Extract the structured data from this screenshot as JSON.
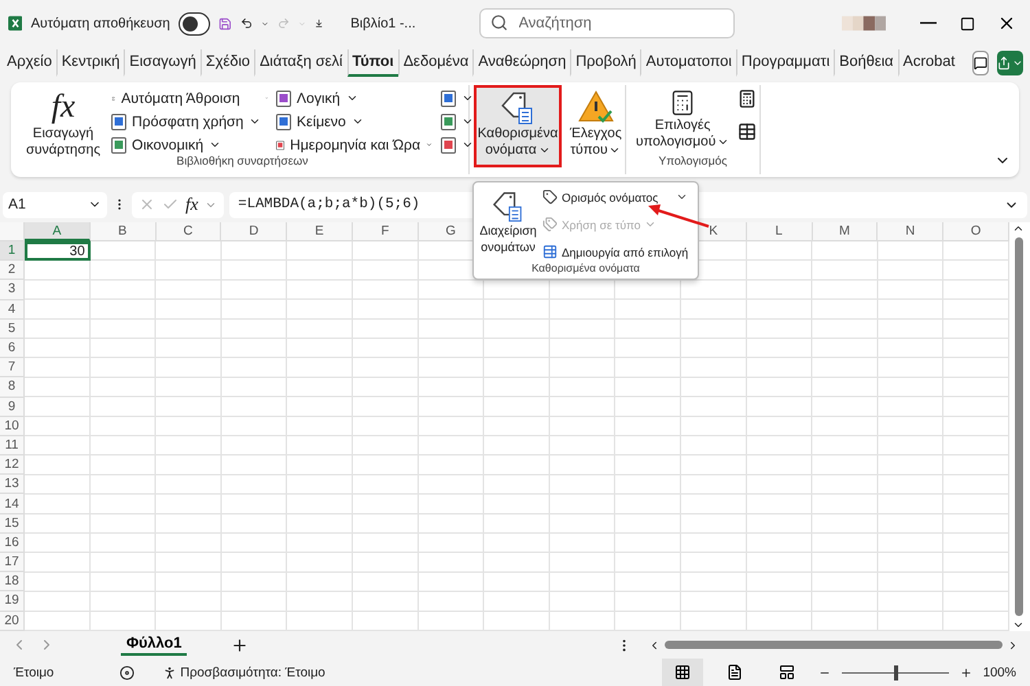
{
  "title_bar": {
    "autosave_label": "Αυτόματη αποθήκευση",
    "autosave_on": false,
    "document_title": "Βιβλίο1 -...",
    "search_placeholder": "Αναζήτηση"
  },
  "tabs": [
    {
      "label": "Αρχείο",
      "selected": false
    },
    {
      "label": "Κεντρική",
      "selected": false
    },
    {
      "label": "Εισαγωγή",
      "selected": false
    },
    {
      "label": "Σχέδιο",
      "selected": false
    },
    {
      "label": "Διάταξη σελί",
      "selected": false
    },
    {
      "label": "Τύποι",
      "selected": true
    },
    {
      "label": "Δεδομένα",
      "selected": false
    },
    {
      "label": "Αναθεώρηση",
      "selected": false
    },
    {
      "label": "Προβολή",
      "selected": false
    },
    {
      "label": "Αυτοματοποι",
      "selected": false
    },
    {
      "label": "Προγραμματι",
      "selected": false
    },
    {
      "label": "Βοήθεια",
      "selected": false
    },
    {
      "label": "Acrobat",
      "selected": false
    }
  ],
  "ribbon": {
    "function_library": {
      "label": "Βιβλιοθήκη συναρτήσεων",
      "insert_function": {
        "glyph": "fx",
        "lines": [
          "Εισαγωγή",
          "συνάρτησης"
        ]
      },
      "columns": [
        [
          {
            "label": "Αυτόματη Άθροιση",
            "kind": "sum",
            "split": true
          },
          {
            "label": "Πρόσφατη χρήση",
            "kind": "book",
            "color": "#2f6fd6"
          },
          {
            "label": "Οικονομική",
            "kind": "book",
            "color": "#3a9a5b"
          }
        ],
        [
          {
            "label": "Λογική",
            "kind": "book",
            "color": "#9b4dca"
          },
          {
            "label": "Κείμενο",
            "kind": "book",
            "color": "#2f6fd6"
          },
          {
            "label": "Ημερομηνία και Ώρα",
            "kind": "book",
            "color": "#e0454f"
          }
        ]
      ],
      "icon_menus": [
        {
          "color": "#2f6fd6"
        },
        {
          "color": "#3a9a5b"
        },
        {
          "color": "#e0454f"
        }
      ]
    },
    "defined_names": {
      "lines": [
        "Καθορισμένα",
        "ονόματα"
      ],
      "highlighted": true,
      "pressed": true
    },
    "formula_auditing": {
      "lines": [
        "Έλεγχος",
        "τύπου"
      ]
    },
    "calculation": {
      "label": "Υπολογισμός",
      "options": {
        "lines": [
          "Επιλογές",
          "υπολογισμού"
        ]
      }
    }
  },
  "formula_bar": {
    "name_box": "A1",
    "fx": "fx",
    "formula": "=LAMBDA(a;b;a*b)(5;6)"
  },
  "grid": {
    "columns": [
      {
        "label": "A",
        "selected": true
      },
      {
        "label": "B",
        "selected": false
      },
      {
        "label": "C",
        "selected": false
      },
      {
        "label": "D",
        "selected": false
      },
      {
        "label": "E",
        "selected": false
      },
      {
        "label": "F",
        "selected": false
      },
      {
        "label": "G",
        "selected": false
      }
    ],
    "columns_after_menu": [
      {
        "label": "K",
        "selected": false
      },
      {
        "label": "L",
        "selected": false
      },
      {
        "label": "M",
        "selected": false
      },
      {
        "label": "N",
        "selected": false
      },
      {
        "label": "O",
        "selected": false
      }
    ],
    "rows": [
      {
        "label": "1",
        "selected": true,
        "cells": [
          {
            "value": "30",
            "selected": true
          }
        ]
      },
      {
        "label": "2",
        "selected": false
      },
      {
        "label": "3",
        "selected": false
      },
      {
        "label": "4",
        "selected": false
      },
      {
        "label": "5",
        "selected": false
      },
      {
        "label": "6",
        "selected": false
      },
      {
        "label": "7",
        "selected": false
      },
      {
        "label": "8",
        "selected": false
      },
      {
        "label": "9",
        "selected": false
      },
      {
        "label": "10",
        "selected": false
      },
      {
        "label": "11",
        "selected": false
      },
      {
        "label": "12",
        "selected": false
      },
      {
        "label": "13",
        "selected": false
      },
      {
        "label": "14",
        "selected": false
      },
      {
        "label": "15",
        "selected": false
      },
      {
        "label": "16",
        "selected": false
      },
      {
        "label": "17",
        "selected": false
      },
      {
        "label": "18",
        "selected": false
      },
      {
        "label": "19",
        "selected": false
      },
      {
        "label": "20",
        "selected": false
      }
    ]
  },
  "sheet_tabs": [
    {
      "label": "Φύλλο1",
      "selected": true
    }
  ],
  "status_bar": {
    "mode": "Έτοιμο",
    "accessibility": "Προσβασιμότητα: Έτοιμο",
    "views": [
      {
        "kind": "normal",
        "selected": true
      },
      {
        "kind": "page_layout",
        "selected": false
      },
      {
        "kind": "page_break",
        "selected": false
      }
    ],
    "zoom": {
      "level": 0.5,
      "label": "100%"
    }
  },
  "names_menu": {
    "manage": {
      "lines": [
        "Διαχείριση",
        "ονομάτων"
      ]
    },
    "label": "Καθορισμένα ονόματα",
    "items": [
      {
        "label": "Ορισμός ονόματος",
        "kind": "define",
        "disabled": false,
        "has_menu": true
      },
      {
        "label": "Χρήση σε τύπο",
        "kind": "use",
        "disabled": true,
        "has_menu": true
      },
      {
        "label": "Δημιουργία από επιλογή",
        "kind": "create",
        "disabled": false,
        "has_menu": false
      }
    ]
  },
  "annotation_arrow": true
}
